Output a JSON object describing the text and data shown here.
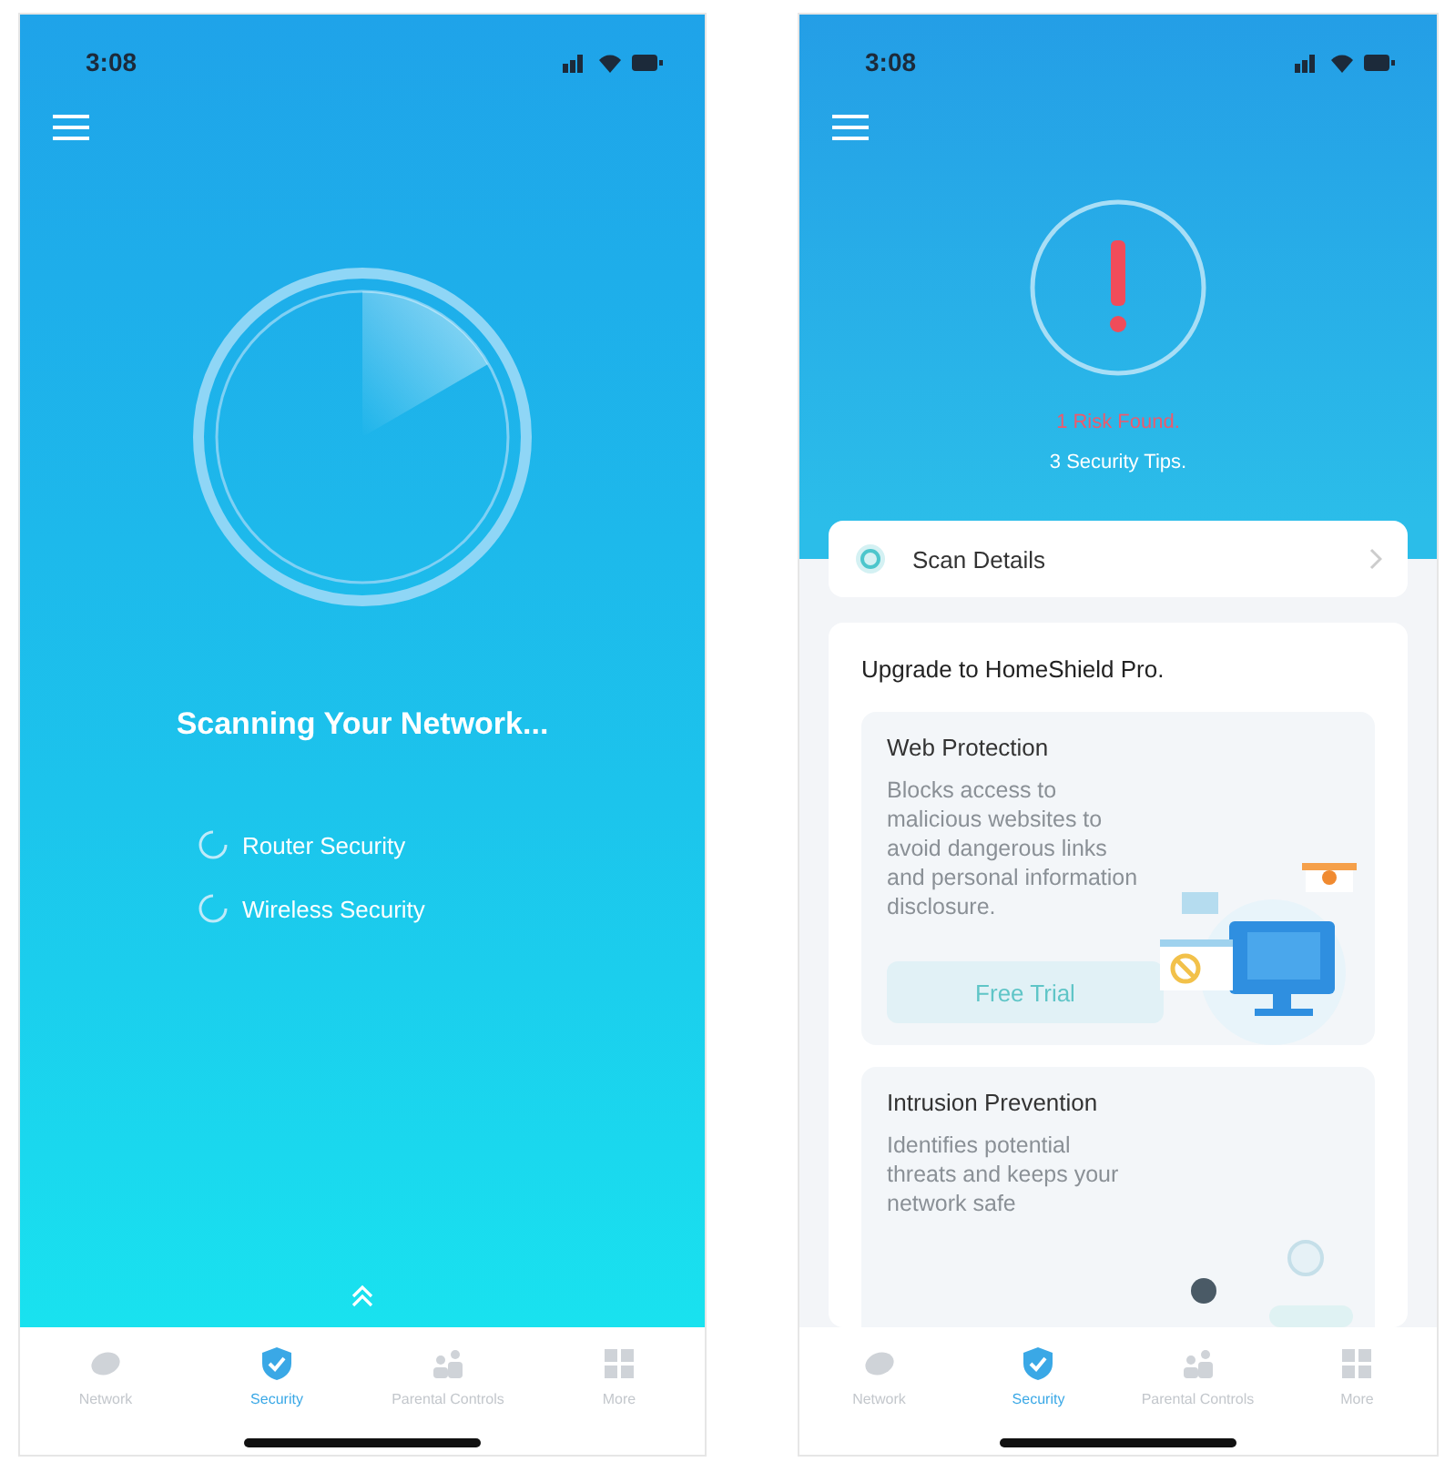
{
  "scanning_screen": {
    "status_bar": {
      "time": "3:08"
    },
    "title": "Scanning Your Network...",
    "checks": [
      {
        "label": "Router Security"
      },
      {
        "label": "Wireless Security"
      }
    ],
    "nav": [
      {
        "label": "Network",
        "selected": false
      },
      {
        "label": "Security",
        "selected": true
      },
      {
        "label": "Parental Controls",
        "selected": false
      },
      {
        "label": "More",
        "selected": false
      }
    ]
  },
  "results_screen": {
    "status_bar": {
      "time": "3:08"
    },
    "risk_text": "1 Risk Found.",
    "tips_text": "3 Security Tips.",
    "scan_details": {
      "label": "Scan Details"
    },
    "upgrade": {
      "title": "Upgrade to HomeShield Pro.",
      "features": [
        {
          "kind": "web",
          "title": "Web Protection",
          "description": "Blocks access to malicious websites to avoid dangerous links and personal information disclosure.",
          "button": "Free Trial"
        },
        {
          "kind": "intrusion",
          "title": "Intrusion Prevention",
          "description": "Identifies potential threats and keeps your network safe"
        }
      ]
    },
    "nav": [
      {
        "label": "Network",
        "selected": false
      },
      {
        "label": "Security",
        "selected": true
      },
      {
        "label": "Parental Controls",
        "selected": false
      },
      {
        "label": "More",
        "selected": false
      }
    ]
  }
}
